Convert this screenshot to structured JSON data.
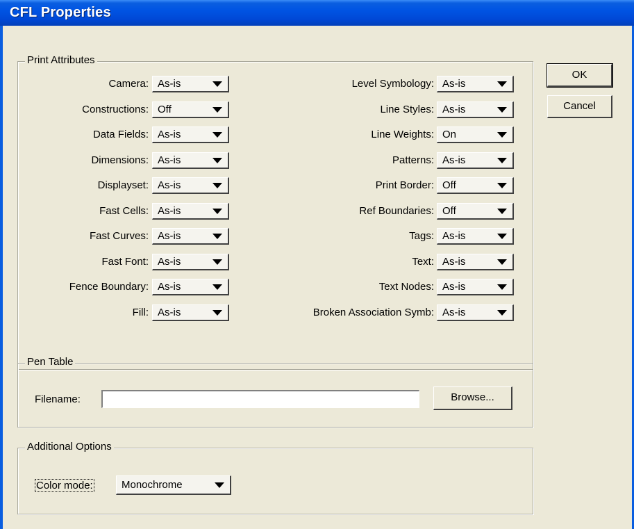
{
  "window": {
    "title": "CFL Properties"
  },
  "buttons": {
    "ok": "OK",
    "cancel": "Cancel"
  },
  "print_attributes": {
    "legend": "Print Attributes",
    "left": [
      {
        "label": "Camera:",
        "value": "As-is"
      },
      {
        "label": "Constructions:",
        "value": "Off"
      },
      {
        "label": "Data Fields:",
        "value": "As-is"
      },
      {
        "label": "Dimensions:",
        "value": "As-is"
      },
      {
        "label": "Displayset:",
        "value": "As-is"
      },
      {
        "label": "Fast Cells:",
        "value": "As-is"
      },
      {
        "label": "Fast Curves:",
        "value": "As-is"
      },
      {
        "label": "Fast Font:",
        "value": "As-is"
      },
      {
        "label": "Fence Boundary:",
        "value": "As-is"
      },
      {
        "label": "Fill:",
        "value": "As-is"
      }
    ],
    "right": [
      {
        "label": "Level Symbology:",
        "value": "As-is"
      },
      {
        "label": "Line Styles:",
        "value": "As-is"
      },
      {
        "label": "Line Weights:",
        "value": "On"
      },
      {
        "label": "Patterns:",
        "value": "As-is"
      },
      {
        "label": "Print Border:",
        "value": "Off"
      },
      {
        "label": "Ref Boundaries:",
        "value": "Off"
      },
      {
        "label": "Tags:",
        "value": "As-is"
      },
      {
        "label": "Text:",
        "value": "As-is"
      },
      {
        "label": "Text Nodes:",
        "value": "As-is"
      },
      {
        "label": "Broken Association Symb:",
        "value": "As-is"
      }
    ]
  },
  "pen_table": {
    "legend": "Pen Table",
    "filename_label": "Filename:",
    "filename_value": "",
    "browse_label": "Browse..."
  },
  "additional_options": {
    "legend": "Additional Options",
    "color_mode_label": "Color mode:",
    "color_mode_value": "Monochrome"
  }
}
